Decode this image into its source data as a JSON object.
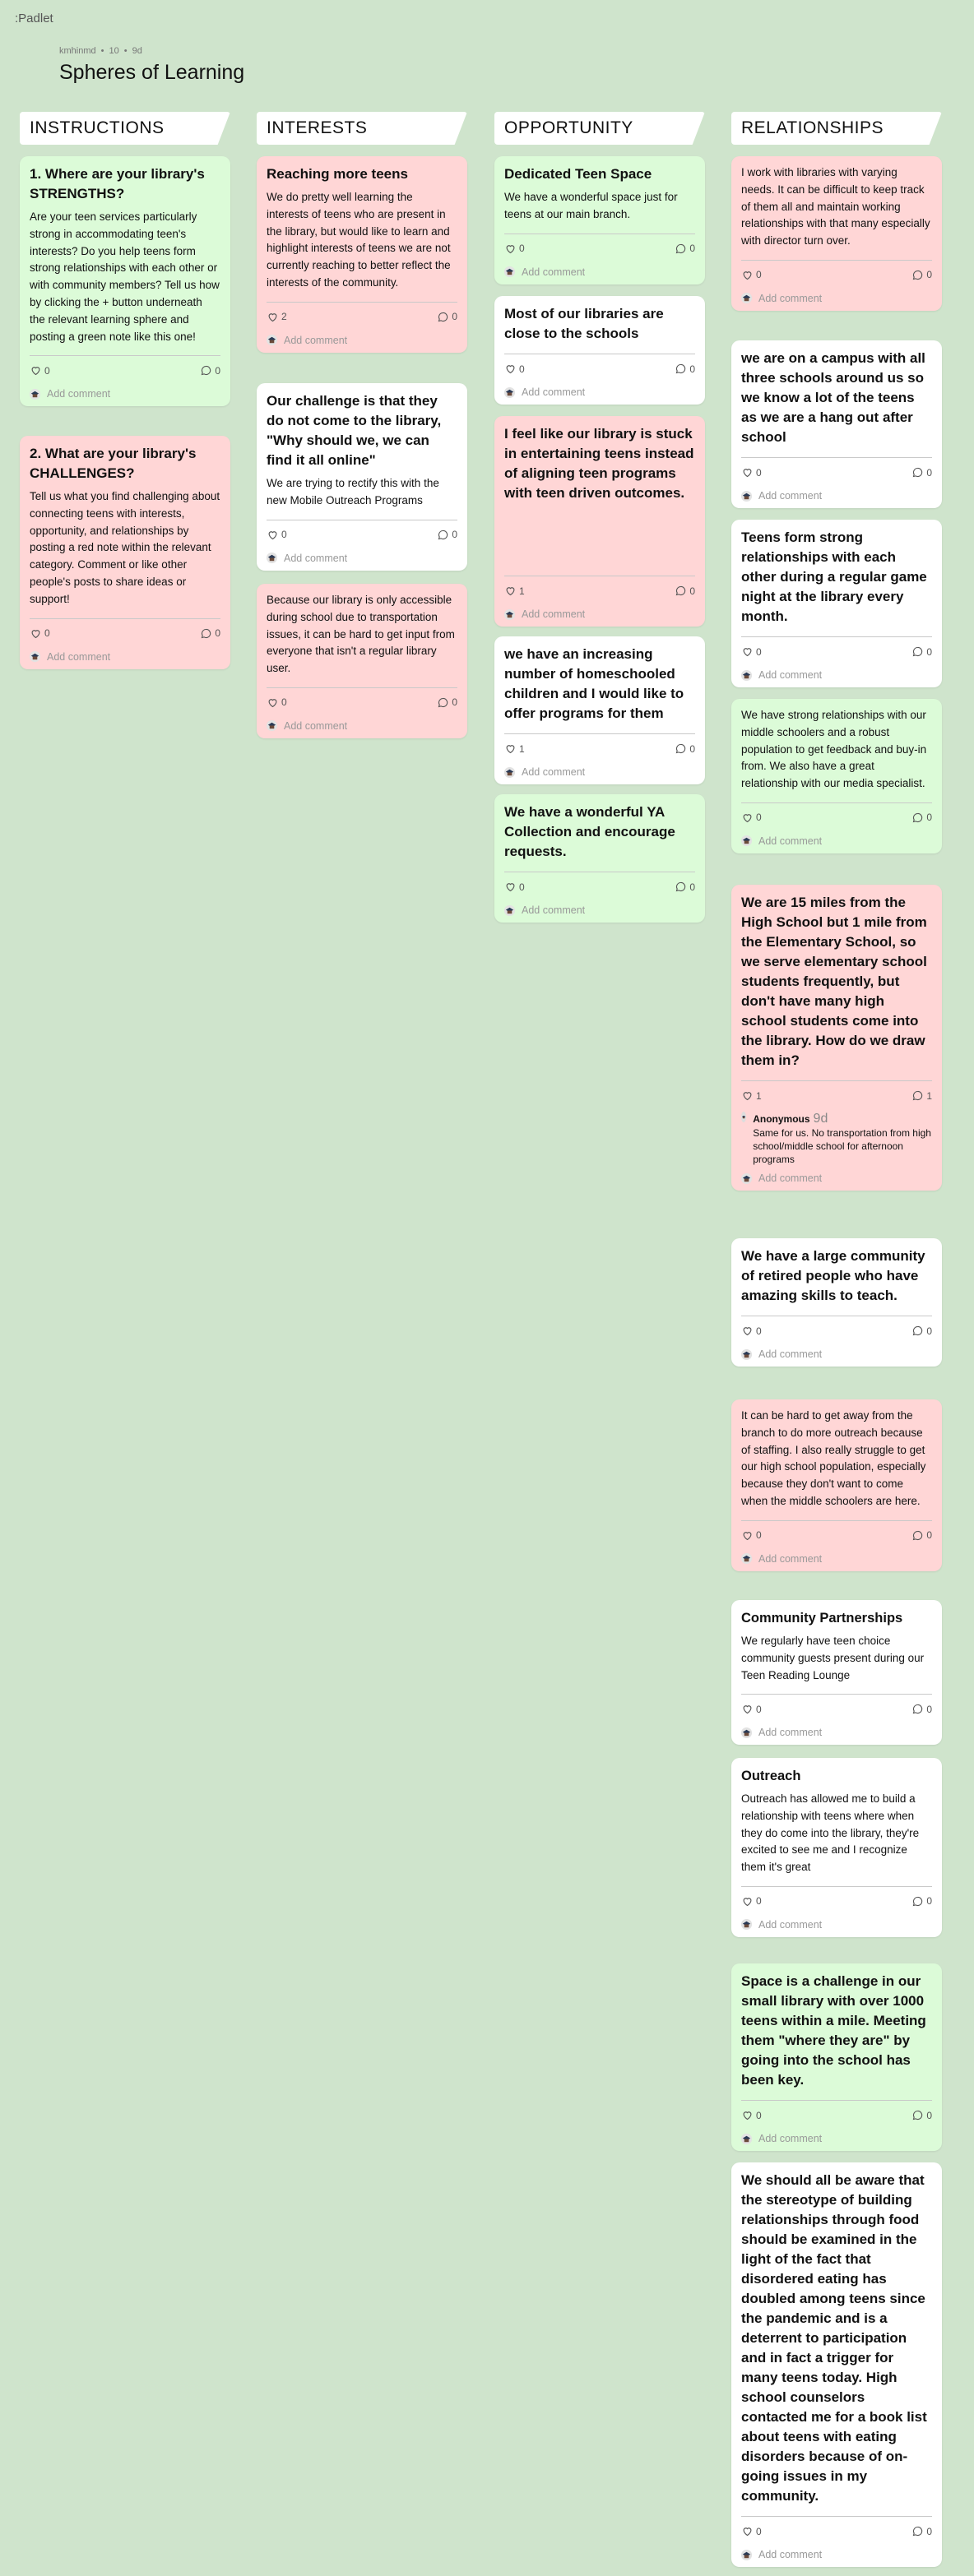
{
  "app": {
    "logo": ":Padlet"
  },
  "board": {
    "author": "kmhinmd",
    "reactions": "10",
    "age": "9d",
    "title": "Spheres of Learning"
  },
  "common": {
    "add_comment": "Add comment"
  },
  "columns": [
    {
      "title": "INSTRUCTIONS"
    },
    {
      "title": "INTERESTS"
    },
    {
      "title": "OPPORTUNITY"
    },
    {
      "title": "RELATIONSHIPS"
    }
  ],
  "posts": {
    "c0": [
      {
        "title": "1. Where are your library's STRENGTHS?",
        "body": "Are your teen services particularly strong in accommodating teen's interests? Do you help teens form strong relationships with each other or with community members? Tell us how by clicking the + button underneath the relevant learning sphere and posting a green note like this one!",
        "likes": "0",
        "comments": "0"
      },
      {
        "title": "2. What are your library's CHALLENGES?",
        "body": "Tell us what you find challenging about connecting teens with interests, opportunity, and relationships by posting a red note within the relevant category. Comment or like other people's posts to share ideas or support!",
        "likes": "0",
        "comments": "0"
      }
    ],
    "c1": [
      {
        "title": "Reaching more teens",
        "body": "We do pretty well learning the interests of teens who are present in the library, but would like to learn and highlight interests of teens we are not currently reaching to better reflect the interests of the community.",
        "likes": "2",
        "comments": "0"
      },
      {
        "title": "Our challenge is that they do not come to the library, \"Why should we, we can find it all online\"",
        "body": "We are trying to rectify this with the new Mobile Outreach Programs",
        "likes": "0",
        "comments": "0"
      },
      {
        "title": "",
        "body": "Because our library is only accessible during school due to transportation issues, it can be hard to get input from everyone that isn't a regular library user.",
        "likes": "0",
        "comments": "0"
      }
    ],
    "c2": [
      {
        "title": "Dedicated Teen Space",
        "body": "We have a wonderful space just for teens at our main branch.",
        "likes": "0",
        "comments": "0"
      },
      {
        "title": "Most of our libraries are close to the schools",
        "body": "",
        "likes": "0",
        "comments": "0"
      },
      {
        "title": "I feel like our library is stuck in entertaining teens instead of aligning teen programs with teen driven outcomes.",
        "body": "",
        "likes": "1",
        "comments": "0"
      },
      {
        "title": "we have an increasing number of homeschooled children and I would like to offer programs for them",
        "body": "",
        "likes": "1",
        "comments": "0"
      },
      {
        "title": "We have a wonderful YA Collection and encourage requests.",
        "body": "",
        "likes": "0",
        "comments": "0"
      }
    ],
    "c3": [
      {
        "title": "",
        "body": "I work with libraries with varying needs. It can be difficult to keep track of them all and maintain working relationships with that many especially with director turn over.",
        "likes": "0",
        "comments": "0"
      },
      {
        "title": "we are on a campus with all three schools around us so we know a lot of the teens as we are a hang out after school",
        "body": "",
        "likes": "0",
        "comments": "0"
      },
      {
        "title": "Teens form strong relationships with each other during a regular game night at the library every month.",
        "body": "",
        "likes": "0",
        "comments": "0"
      },
      {
        "title": "",
        "body": "We have strong relationships with our middle schoolers and a robust population to get feedback and buy-in from. We also have a great relationship with our media specialist.",
        "likes": "0",
        "comments": "0"
      },
      {
        "title": "We are 15 miles from the High School but 1 mile from the Elementary School, so we serve elementary school students frequently, but don't have many high school students come into the library. How do we draw them in?",
        "body": "",
        "likes": "1",
        "comments": "1",
        "comment": {
          "author": "Anonymous",
          "time": "9d",
          "text": "Same for us. No transportation from high school/middle school for afternoon programs"
        }
      },
      {
        "title": "We have a large community of retired people who have amazing skills to teach.",
        "body": "",
        "likes": "0",
        "comments": "0"
      },
      {
        "title": "",
        "body": "It can be hard to get away from the branch to do more outreach because of staffing. I also really struggle to get our high school population, especially because they don't want to come when the middle schoolers are here.",
        "likes": "0",
        "comments": "0"
      },
      {
        "title": "Community Partnerships",
        "body": "We regularly have teen choice community guests present during our Teen Reading Lounge",
        "likes": "0",
        "comments": "0"
      },
      {
        "title": "Outreach",
        "body": "Outreach has allowed me to build a relationship with teens where when they do come into the library, they're excited to see me and I recognize them it's great",
        "likes": "0",
        "comments": "0"
      },
      {
        "title": "Space is a challenge in our small library with over 1000 teens within a mile. Meeting them \"where they are\" by going into the school has been key.",
        "body": "",
        "likes": "0",
        "comments": "0"
      },
      {
        "title": "We should all be aware that the stereotype of building relationships through food should be examined in the light of the fact that disordered eating has doubled among teens since the pandemic and is a deterrent to participation and in fact a trigger for many teens today. High school counselors contacted me for a book list about teens with eating disorders because of on-going issues in my community.",
        "body": "",
        "likes": "0",
        "comments": "0"
      }
    ]
  },
  "colors": {
    "background": "#cfe4cc",
    "green_note": "#dcfbd8",
    "red_note": "#ffd6d6",
    "white_note": "#ffffff"
  },
  "icons": {
    "like": "heart-icon",
    "comment": "comment-bubble-icon",
    "avatar": "user-avatar-icon"
  }
}
